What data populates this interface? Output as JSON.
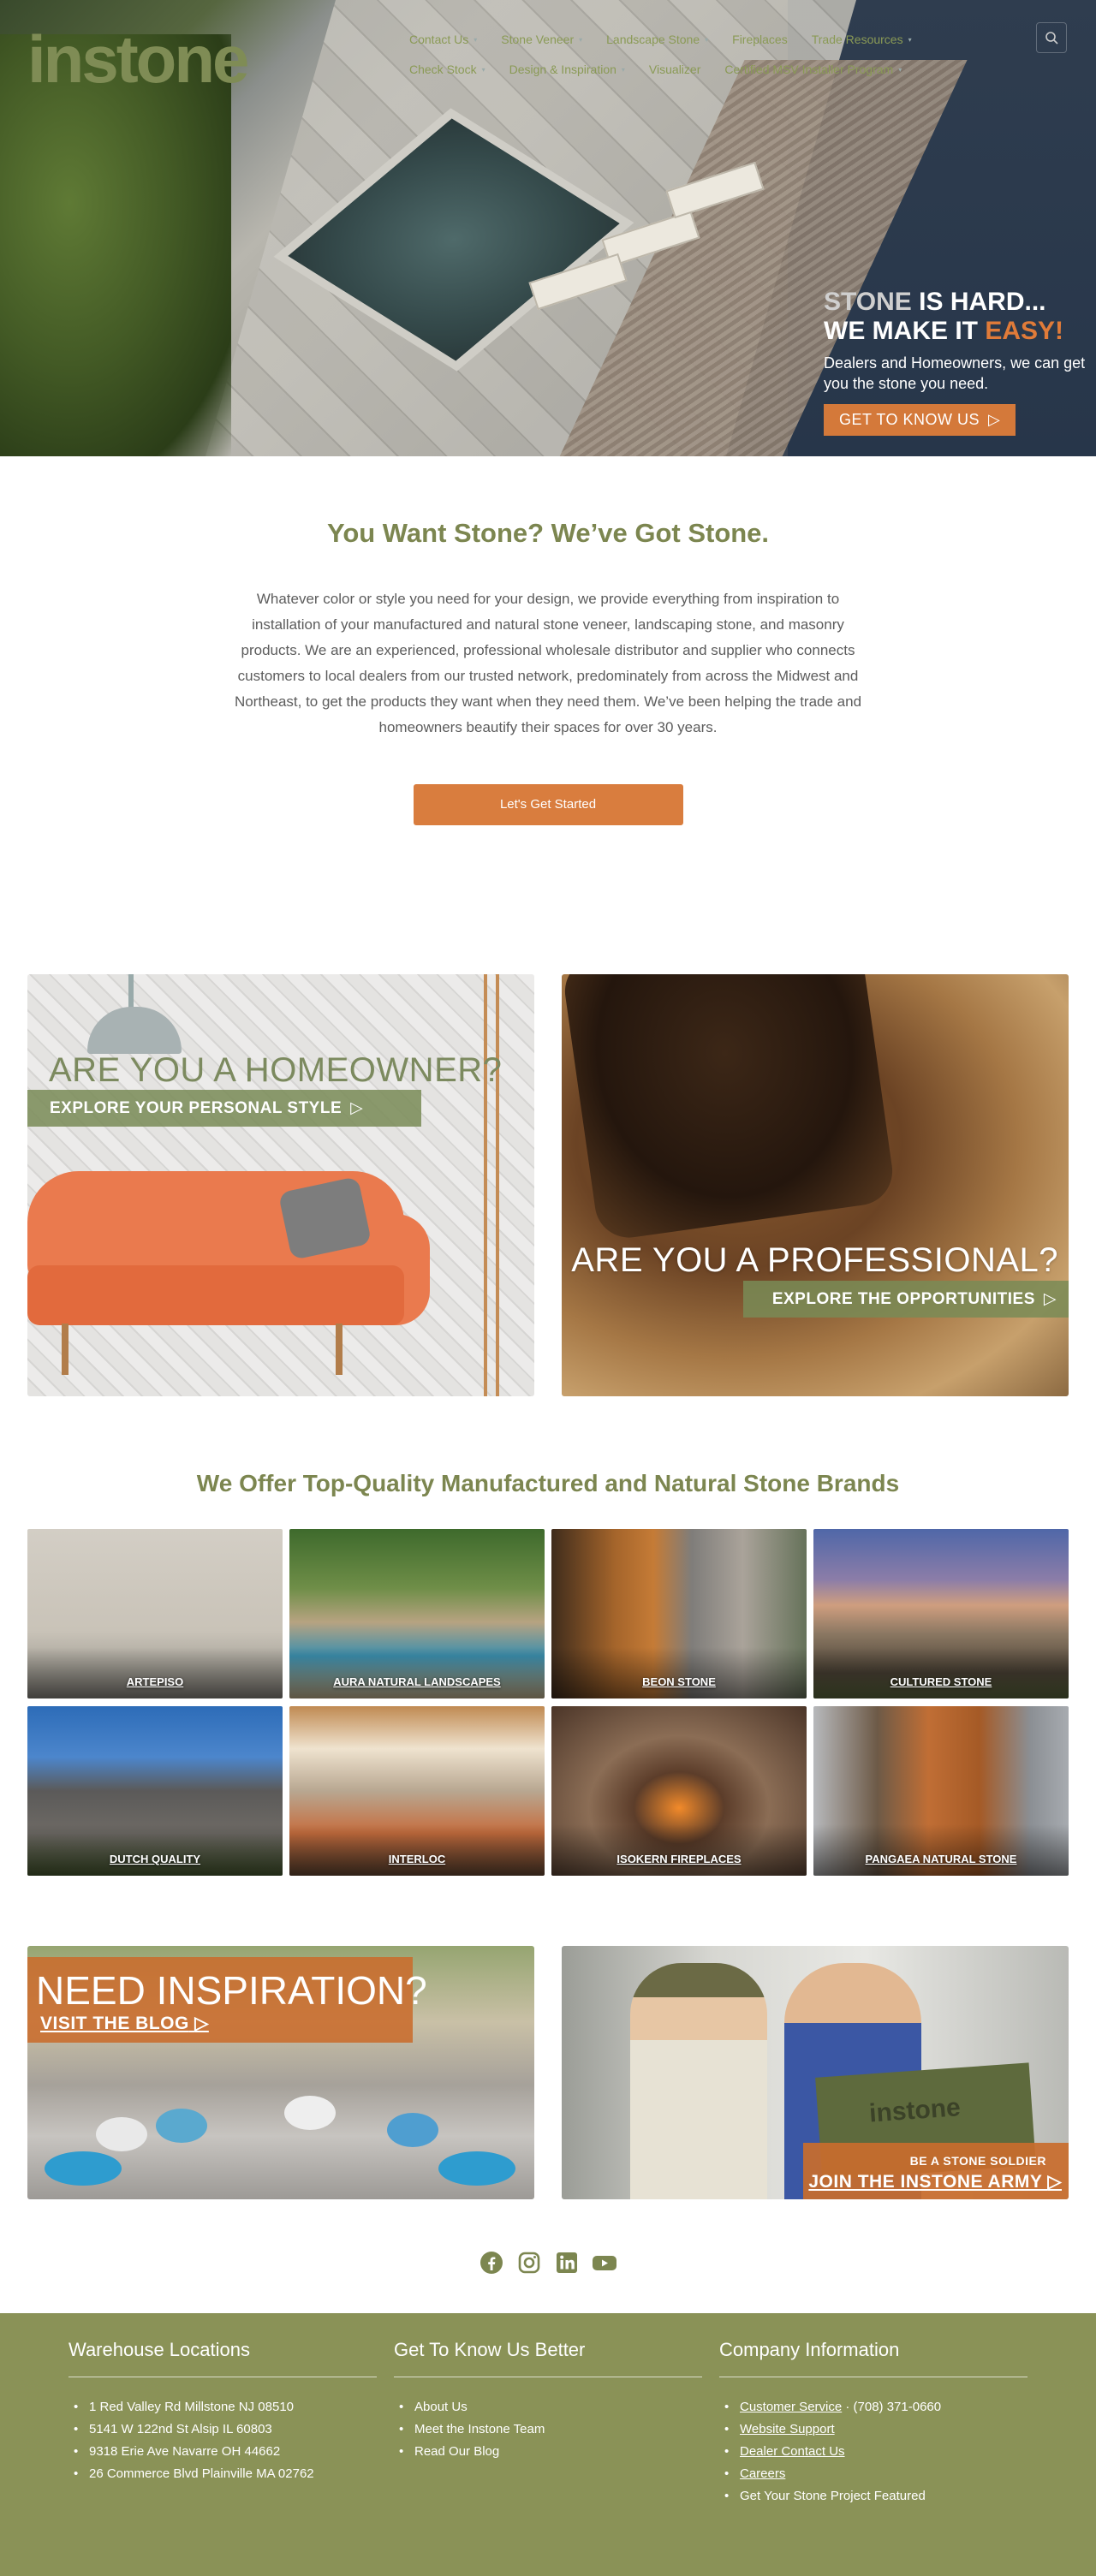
{
  "header": {
    "logo": "instone",
    "menu_row1": [
      {
        "label": "Contact Us",
        "dropdown": true
      },
      {
        "label": "Stone Veneer",
        "dropdown": true
      },
      {
        "label": "Landscape Stone",
        "dropdown": true
      },
      {
        "label": "Fireplaces",
        "dropdown": false
      },
      {
        "label": "Trade Resources",
        "dropdown": true
      }
    ],
    "menu_row2": [
      {
        "label": "Check Stock",
        "dropdown": true
      },
      {
        "label": "Design & Inspiration",
        "dropdown": true
      },
      {
        "label": "Visualizer",
        "dropdown": false
      },
      {
        "label": "Certified MSV Installer Program",
        "dropdown": true
      }
    ],
    "search_icon": "search-icon"
  },
  "hero": {
    "line1_a": "STONE",
    "line1_b": " IS HARD...",
    "line2_a": "WE MAKE IT ",
    "line2_b": "EASY!",
    "subtitle": "Dealers and Homeowners, we can get you the stone you need.",
    "button": "GET TO KNOW US",
    "button_icon": "play-triangle-icon"
  },
  "intro": {
    "title": "You Want Stone? We’ve Got Stone.",
    "body": "Whatever color or style you need for your design, we provide everything from inspiration to installation of your manufactured and natural stone veneer, landscaping stone, and masonry products. We are an experienced, professional wholesale distributor and supplier who connects customers to local dealers from our trusted network, predominately from across the Midwest and Northeast, to get the products they want when they need them. We’ve been helping the trade and homeowners beautify their spaces for over 30 years.",
    "cta": "Let's Get Started"
  },
  "audience": {
    "homeowner_title": "ARE YOU A HOMEOWNER?",
    "homeowner_link": "EXPLORE YOUR PERSONAL STYLE",
    "pro_title": "ARE YOU A PROFESSIONAL?",
    "pro_link": "EXPLORE THE OPPORTUNITIES",
    "arrow": "▷"
  },
  "brands": {
    "heading": "We Offer Top-Quality Manufactured and Natural Stone Brands",
    "items": [
      "ARTEPISO",
      "AURA NATURAL LANDSCAPES",
      "BEON STONE",
      "CULTURED STONE",
      "DUTCH QUALITY",
      "INTERLOC",
      "ISOKERN FIREPLACES",
      "PANGAEA NATURAL STONE"
    ]
  },
  "promo": {
    "insp_title": "NEED INSPIRATION?",
    "insp_link": "VISIT THE BLOG",
    "army_tagline": "BE A STONE SOLDIER",
    "army_link": "JOIN THE INSTONE ARMY",
    "shirt_logo": "instone",
    "arrow": "▷"
  },
  "social": [
    "facebook-icon",
    "instagram-icon",
    "linkedin-icon",
    "youtube-icon"
  ],
  "footer": {
    "col1_title": "Warehouse Locations",
    "col1_items": [
      "1 Red Valley Rd Millstone NJ 08510",
      "5141 W 122nd St Alsip IL 60803",
      "9318 Erie Ave Navarre OH 44662",
      "26 Commerce Blvd Plainville MA 02762"
    ],
    "col2_title": "Get To Know Us Better",
    "col2_items": [
      "About Us",
      "Meet the Instone Team",
      "Read Our Blog"
    ],
    "col3_title": "Company Information",
    "col3_link1": "Customer Service",
    "col3_phone": " · (708) 371-0660",
    "col3_items": [
      "Website Support",
      "Dealer Contact Us",
      "Careers"
    ],
    "col3_last": "Get Your Stone Project Featured"
  },
  "colors": {
    "brand_green": "#7c8650",
    "accent_orange": "#d97d3e",
    "footer_green": "#8a9257"
  }
}
